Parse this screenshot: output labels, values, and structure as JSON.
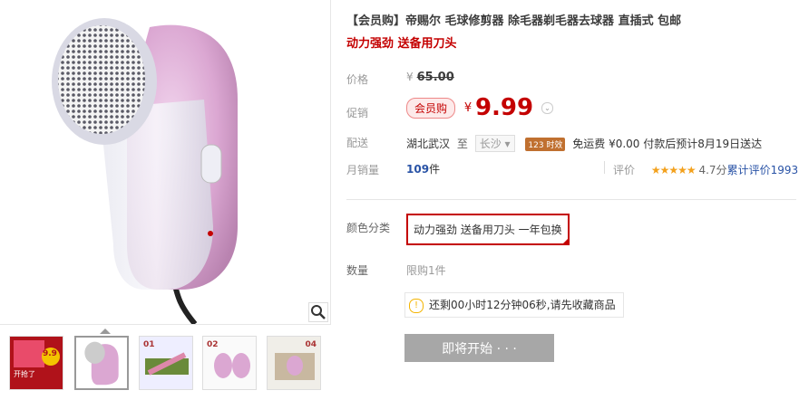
{
  "product": {
    "title": "【会员购】帝赐尔 毛球修剪器 除毛器剃毛器去球器 直插式 包邮",
    "subtitle": "动力强劲 送备用刀头"
  },
  "price": {
    "label": "价格",
    "currency": "¥",
    "original": "65.00"
  },
  "promo": {
    "label": "促销",
    "badge": "会员购",
    "currency": "¥",
    "price": "9.99"
  },
  "delivery": {
    "label": "配送",
    "origin": "湖北武汉",
    "to": "至",
    "dest": "长沙",
    "time_badge": "123 时效",
    "shipping": "免运费 ¥0.00 付款后预计8月19日送达"
  },
  "sales": {
    "label": "月销量",
    "count": "109",
    "unit": "件",
    "rating_label": "评价",
    "stars": "★★★★★",
    "score": "4.7分",
    "reviews": "累计评价1993"
  },
  "options": {
    "color_label": "颜色分类",
    "selected": "动力强劲 送备用刀头 一年包换"
  },
  "quantity": {
    "label": "数量",
    "limit": "限购1件"
  },
  "notice": {
    "text": "还剩00小时12分钟06秒,请先收藏商品"
  },
  "buy_button": "即将开始 · · ·",
  "thumb_labels": {
    "t0_badge": "9.9",
    "t0_text": "开抢了",
    "t2_num": "01",
    "t3_num": "02",
    "t4_num": "04"
  },
  "colors": {
    "accent": "#c40000",
    "link": "#2953a6",
    "button_disabled": "#a7a7a7",
    "product_pink": "#e0b4d8"
  },
  "icons": [
    "zoom-icon",
    "chevron-down-icon",
    "bulb-icon",
    "star-icon"
  ]
}
